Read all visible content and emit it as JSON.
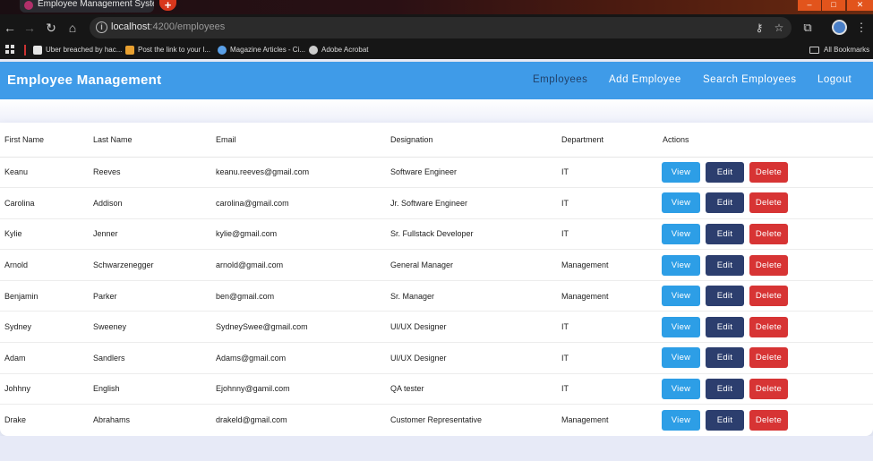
{
  "browser": {
    "tab_title": "Employee Management System",
    "new_tab_symbol": "+",
    "url_host": "localhost",
    "url_path": ":4200/employees",
    "bookmarks": [
      {
        "label": "Uber breached by hac...",
        "icon": "uber-icon",
        "color": "#e6e6e6"
      },
      {
        "label": "Post the link to your l...",
        "icon": "pin-icon",
        "color": "#e8a030"
      },
      {
        "label": "Magazine Articles - Ci...",
        "icon": "cloud-icon",
        "color": "#5aa0e8"
      },
      {
        "label": "Adobe Acrobat",
        "icon": "globe-icon",
        "color": "#cccccc"
      }
    ],
    "all_bookmarks": "All Bookmarks"
  },
  "app": {
    "brand": "Employee Management",
    "nav": [
      {
        "label": "Employees",
        "active": true
      },
      {
        "label": "Add Employee",
        "active": false
      },
      {
        "label": "Search Employees",
        "active": false
      },
      {
        "label": "Logout",
        "active": false
      }
    ]
  },
  "table": {
    "headers": [
      "First Name",
      "Last Name",
      "Email",
      "Designation",
      "Department",
      "Actions"
    ],
    "rows": [
      [
        "Keanu",
        "Reeves",
        "keanu.reeves@gmail.com",
        "Software Engineer",
        "IT"
      ],
      [
        "Carolina",
        "Addison",
        "carolina@gmail.com",
        "Jr. Software Engineer",
        "IT"
      ],
      [
        "Kylie",
        "Jenner",
        "kylie@gmail.com",
        "Sr. Fullstack Developer",
        "IT"
      ],
      [
        "Arnold",
        "Schwarzenegger",
        "arnold@gmail.com",
        "General Manager",
        "Management"
      ],
      [
        "Benjamin",
        "Parker",
        "ben@gmail.com",
        "Sr. Manager",
        "Management"
      ],
      [
        "Sydney",
        "Sweeney",
        "SydneySwee@gmail.com",
        "UI/UX Designer",
        "IT"
      ],
      [
        "Adam",
        "Sandlers",
        "Adams@gmail.com",
        "UI/UX Designer",
        "IT"
      ],
      [
        "Johhny",
        "English",
        "Ejohnny@gamil.com",
        "QA tester",
        "IT"
      ],
      [
        "Drake",
        "Abrahams",
        "drakeld@gmail.com",
        "Customer Representative",
        "Management"
      ]
    ],
    "actions": {
      "view": "View",
      "edit": "Edit",
      "delete": "Delete"
    }
  },
  "colors": {
    "navbar": "#3f9be8",
    "view_button": "#2d9ee6",
    "edit_button": "#2c3e6e",
    "delete_button": "#d73434"
  }
}
